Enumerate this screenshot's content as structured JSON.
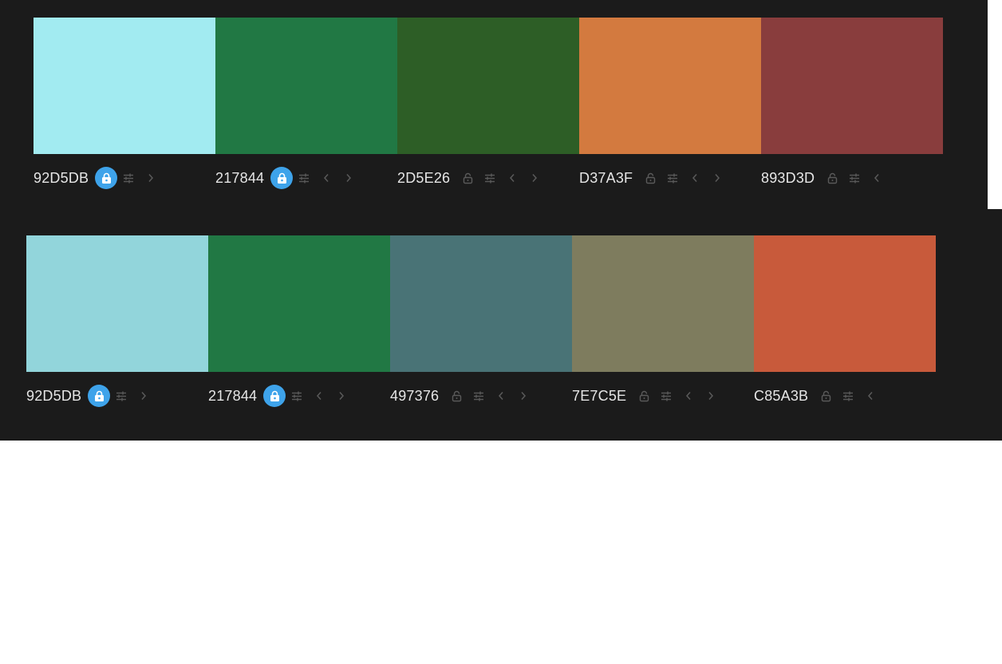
{
  "palettes": [
    {
      "colors": [
        {
          "hex": "92D5DB",
          "swatch": "#A2EBF1",
          "locked": true,
          "arrows": [
            "right"
          ]
        },
        {
          "hex": "217844",
          "swatch": "#217844",
          "locked": true,
          "arrows": [
            "left",
            "right"
          ]
        },
        {
          "hex": "2D5E26",
          "swatch": "#2D5E26",
          "locked": false,
          "arrows": [
            "left",
            "right"
          ]
        },
        {
          "hex": "D37A3F",
          "swatch": "#D37A3F",
          "locked": false,
          "arrows": [
            "left",
            "right"
          ]
        },
        {
          "hex": "893D3D",
          "swatch": "#893D3D",
          "locked": false,
          "arrows": [
            "left"
          ]
        }
      ]
    },
    {
      "colors": [
        {
          "hex": "92D5DB",
          "swatch": "#92D5DB",
          "locked": true,
          "arrows": [
            "right"
          ]
        },
        {
          "hex": "217844",
          "swatch": "#217844",
          "locked": true,
          "arrows": [
            "left",
            "right"
          ]
        },
        {
          "hex": "497376",
          "swatch": "#497376",
          "locked": false,
          "arrows": [
            "left",
            "right"
          ]
        },
        {
          "hex": "7E7C5E",
          "swatch": "#7E7C5E",
          "locked": false,
          "arrows": [
            "left",
            "right"
          ]
        },
        {
          "hex": "C85A3B",
          "swatch": "#C85A3B",
          "locked": false,
          "arrows": [
            "left"
          ]
        }
      ]
    }
  ],
  "icons": {
    "lock": "lock-icon",
    "adjust": "sliders-icon",
    "left": "chevron-left-icon",
    "right": "chevron-right-icon"
  },
  "colors": {
    "background": "#1B1B1B",
    "lock_active": "#3EA3EA",
    "icon_muted": "#5A5A5A",
    "text": "#E6E6E6"
  }
}
